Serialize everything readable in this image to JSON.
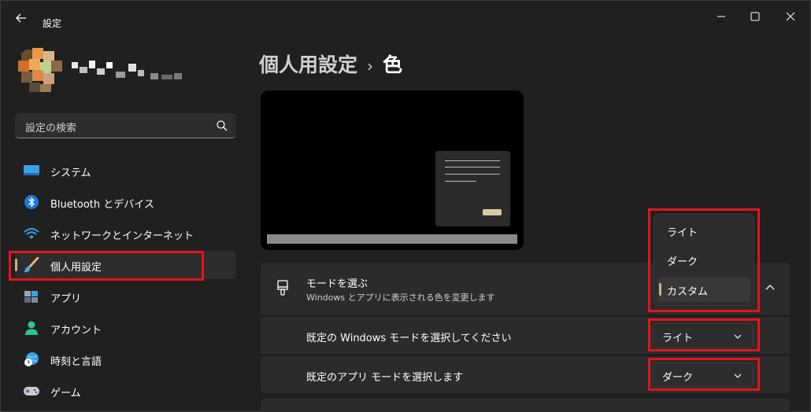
{
  "window": {
    "title": "設定",
    "controls": [
      "minimize-icon",
      "maximize-icon",
      "close-icon"
    ]
  },
  "sidebar": {
    "search_placeholder": "設定の検索",
    "items": [
      {
        "label": "システム",
        "icon": "system-icon"
      },
      {
        "label": "Bluetooth とデバイス",
        "icon": "bluetooth-icon"
      },
      {
        "label": "ネットワークとインターネット",
        "icon": "wifi-icon"
      },
      {
        "label": "個人用設定",
        "icon": "brush-icon",
        "selected": true
      },
      {
        "label": "アプリ",
        "icon": "apps-icon"
      },
      {
        "label": "アカウント",
        "icon": "account-icon"
      },
      {
        "label": "時刻と言語",
        "icon": "time-language-icon"
      },
      {
        "label": "ゲーム",
        "icon": "gamepad-icon"
      }
    ]
  },
  "breadcrumb": {
    "parent": "個人用設定",
    "separator": "›",
    "current": "色"
  },
  "mode_card": {
    "title": "モードを選ぶ",
    "subtitle": "Windows とアプリに表示される色を変更します",
    "expanded": true
  },
  "mode_dropdown": {
    "options": [
      "ライト",
      "ダーク",
      "カスタム"
    ],
    "selected": "カスタム"
  },
  "windows_mode_row": {
    "label": "既定の Windows モードを選択してください",
    "value": "ライト"
  },
  "app_mode_row": {
    "label": "既定のアプリ モードを選択します",
    "value": "ダーク"
  },
  "colors": {
    "accent": "#c9b48a",
    "highlight": "#e3141c",
    "background": "#202020",
    "card": "#2b2b2b"
  }
}
